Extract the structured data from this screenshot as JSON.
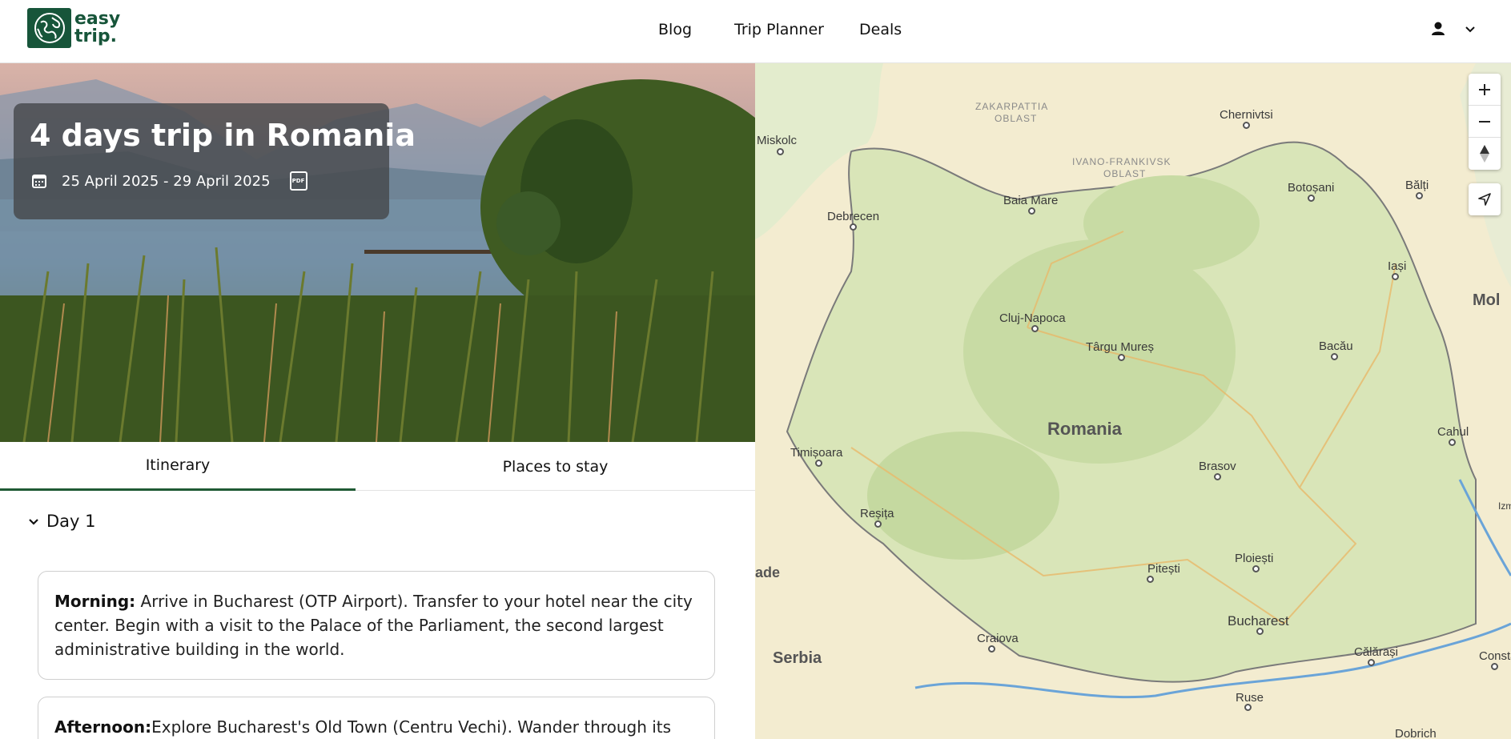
{
  "header": {
    "logo_line1": "easy",
    "logo_line2": "trip.",
    "nav": [
      "Blog",
      "Trip Planner",
      "Deals"
    ]
  },
  "hero": {
    "title": "4 days trip in Romania",
    "dates": "25 April 2025 - 29 April 2025",
    "pdf_label": "PDF"
  },
  "tabs": [
    "Itinerary",
    "Places to stay"
  ],
  "itinerary": {
    "day_label": "Day 1",
    "entries": [
      {
        "label": "Morning:",
        "text": " Arrive in Bucharest (OTP Airport). Transfer to your hotel near the city center. Begin with a visit to the Palace of the Parliament, the second largest administrative building in the world."
      },
      {
        "label": "Afternoon:",
        "text": "Explore Bucharest's Old Town (Centru Vechi). Wander through its"
      }
    ]
  },
  "map": {
    "country": "Romania",
    "regions": [
      "ZAKARPATTIA",
      "OBLAST",
      "IVANO-FRANKIVSK",
      "OBLAST"
    ],
    "cities": [
      "Miskolc",
      "Chernivtsi",
      "Debrecen",
      "Baia Mare",
      "Botoșani",
      "Bălți",
      "Iași",
      "Cluj-Napoca",
      "Târgu Mureș",
      "Bacău",
      "Timișoara",
      "Brasov",
      "Cahul",
      "Reșița",
      "Pitești",
      "Ploiești",
      "Craiova",
      "Bucharest",
      "Călărași",
      "Ruse",
      "Dobrich",
      "Constan",
      "Izm"
    ],
    "edge_labels": [
      "Mol",
      "ade",
      "Serbia"
    ]
  },
  "colors": {
    "brand": "#17553a",
    "tab_underline": "#1f5a34",
    "hero_card": "#46484c"
  }
}
